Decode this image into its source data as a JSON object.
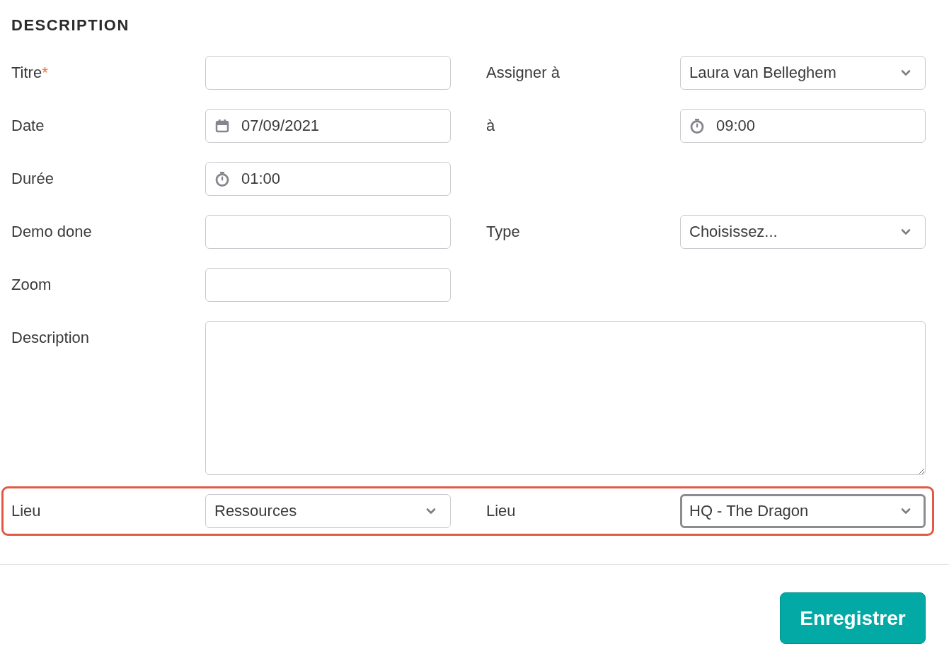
{
  "section_title": "DESCRIPTION",
  "rows": [
    {
      "highlighted": false,
      "cells": [
        {
          "label": "Titre",
          "required_mark": "*",
          "field": {
            "kind": "text"
          }
        },
        {
          "label": "Assigner à",
          "field": {
            "kind": "select",
            "value": "Laura van Belleghem",
            "focused": false
          }
        }
      ]
    },
    {
      "highlighted": false,
      "cells": [
        {
          "label": "Date",
          "field": {
            "kind": "date",
            "value": "07/09/2021"
          }
        },
        {
          "label": "à",
          "field": {
            "kind": "time",
            "value": "09:00"
          }
        }
      ]
    },
    {
      "highlighted": false,
      "cells": [
        {
          "label": "Durée",
          "field": {
            "kind": "time",
            "value": "01:00"
          }
        }
      ]
    },
    {
      "highlighted": false,
      "cells": [
        {
          "label": "Demo done",
          "field": {
            "kind": "text"
          }
        },
        {
          "label": "Type",
          "field": {
            "kind": "select",
            "value": "Choisissez...",
            "focused": false
          }
        }
      ]
    },
    {
      "highlighted": false,
      "cells": [
        {
          "label": "Zoom",
          "field": {
            "kind": "text"
          }
        }
      ]
    },
    {
      "highlighted": false,
      "cells": [
        {
          "label": "Description",
          "field": {
            "kind": "textarea"
          }
        }
      ]
    },
    {
      "highlighted": true,
      "cells": [
        {
          "label": "Lieu",
          "field": {
            "kind": "select",
            "value": "Ressources",
            "focused": false
          }
        },
        {
          "label": "Lieu",
          "field": {
            "kind": "select",
            "value": "HQ - The Dragon",
            "focused": true
          }
        }
      ]
    }
  ],
  "save_button": "Enregistrer"
}
